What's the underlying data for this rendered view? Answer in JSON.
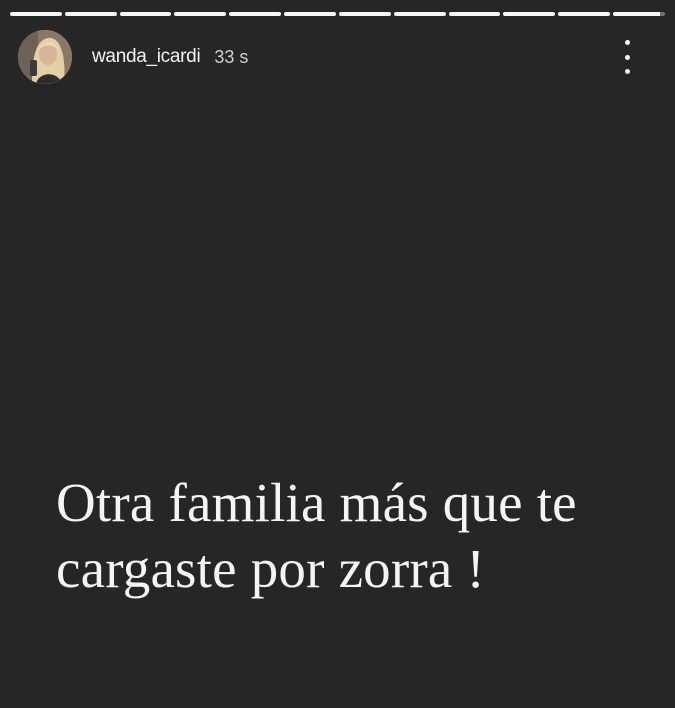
{
  "progress": {
    "segments": [
      1,
      1,
      1,
      1,
      1,
      1,
      1,
      1,
      1,
      1,
      1,
      0.9
    ]
  },
  "header": {
    "avatar_icon": "profile-photo",
    "username": "wanda_icardi",
    "timestamp": "33 s",
    "more_icon": "vertical-ellipsis-icon"
  },
  "story": {
    "text": "Otra familia más que te cargaste por zorra !",
    "background_color": "#262626",
    "text_color": "#f4f4f4"
  }
}
